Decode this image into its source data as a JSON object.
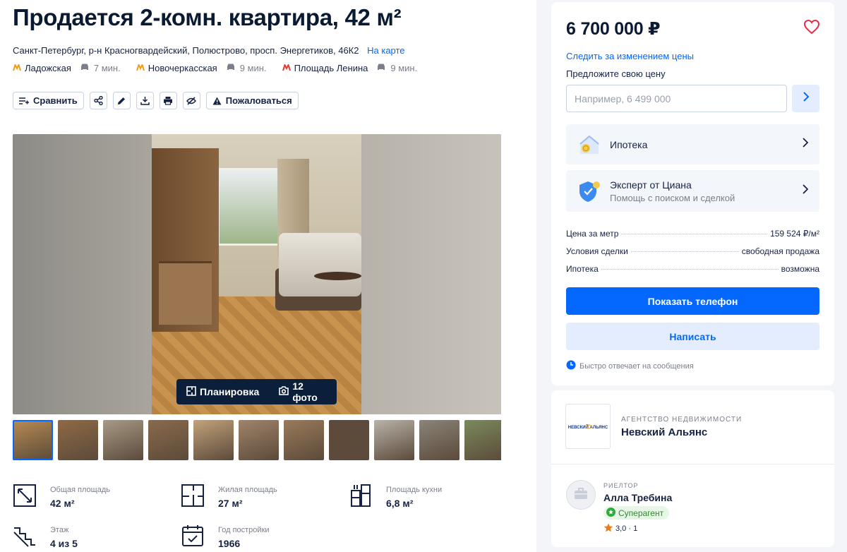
{
  "listing": {
    "title": "Продается 2-комн. квартира, 42 м²",
    "address": "Санкт-Петербург, р-н Красногвардейский, Полюстрово, просп. Энергетиков, 46К2",
    "map_link": "На карте",
    "metro": [
      {
        "name": "Ладожская",
        "time": "7 мин."
      },
      {
        "name": "Новочеркасская",
        "time": "9 мин."
      },
      {
        "name": "Площадь Ленина",
        "time": "9 мин."
      }
    ],
    "metro_color": "#f39c12"
  },
  "toolbar": {
    "compare_label": "Сравнить",
    "report_label": "Пожаловаться",
    "icons": [
      "share-icon",
      "edit-icon",
      "download-icon",
      "print-icon",
      "hide-icon"
    ]
  },
  "gallery": {
    "layout_label": "Планировка",
    "photos_label": "12 фото",
    "thumb_colors": [
      "#b88b52",
      "#8f6a45",
      "#a89a86",
      "#8a6a4c",
      "#c2a27a",
      "#a0846a",
      "#9a7a5a",
      "#5e4a3a",
      "#b9b3a8",
      "#8a8478",
      "#7a8a5c"
    ]
  },
  "params": [
    {
      "label": "Общая площадь",
      "value": "42 м²",
      "icon": "area-icon"
    },
    {
      "label": "Жилая площадь",
      "value": "27 м²",
      "icon": "living-area-icon"
    },
    {
      "label": "Площадь кухни",
      "value": "6,8 м²",
      "icon": "kitchen-icon"
    },
    {
      "label": "Этаж",
      "value": "4 из 5",
      "icon": "stairs-icon"
    },
    {
      "label": "Год постройки",
      "value": "1966",
      "icon": "calendar-icon"
    }
  ],
  "sidebar": {
    "price": "6 700 000 ₽",
    "watch_price": "Следить за изменением цены",
    "offer_label": "Предложите свою цену",
    "offer_placeholder": "Например, 6 499 000",
    "mortgage_card": "Ипотека",
    "expert_title": "Эксперт от Циана",
    "expert_sub": "Помощь с поиском и сделкой",
    "facts": [
      {
        "key": "Цена за метр",
        "value": "159 524 ₽/м²"
      },
      {
        "key": "Условия сделки",
        "value": "свободная продажа"
      },
      {
        "key": "Ипотека",
        "value": "возможна"
      }
    ],
    "show_phone": "Показать телефон",
    "write": "Написать",
    "fast_reply": "Быстро отвечает на сообщения",
    "accent": "#0468ff"
  },
  "agent": {
    "agency_logo_text": "НЕВСКИЙ АЛЬЯНС",
    "agency_kind": "АГЕНТСТВО НЕДВИЖИМОСТИ",
    "agency_name": "Невский Альянс",
    "realtor_kind": "РИЕЛТОР",
    "realtor_name": "Алла Требина",
    "badge": "Суперагент",
    "rating": "3,0 · 1"
  }
}
